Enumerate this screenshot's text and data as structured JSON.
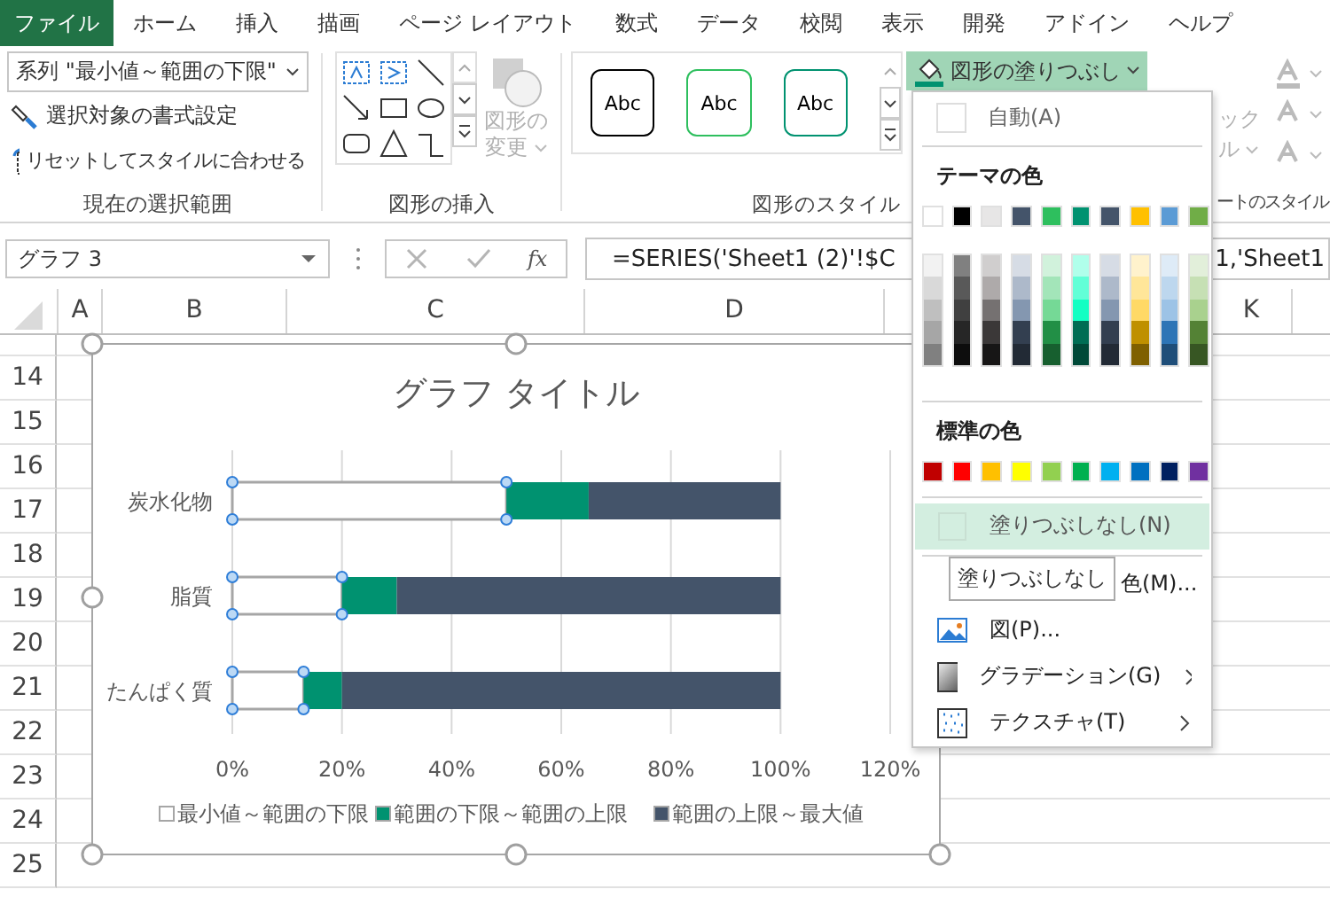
{
  "tabs": [
    {
      "label": "ファイル",
      "kind": "file"
    },
    {
      "label": "ホーム",
      "kind": "tab"
    },
    {
      "label": "挿入",
      "kind": "tab"
    },
    {
      "label": "描画",
      "kind": "tab"
    },
    {
      "label": "ページ レイアウト",
      "kind": "tab"
    },
    {
      "label": "数式",
      "kind": "tab"
    },
    {
      "label": "データ",
      "kind": "tab"
    },
    {
      "label": "校閲",
      "kind": "tab"
    },
    {
      "label": "表示",
      "kind": "tab"
    },
    {
      "label": "開発",
      "kind": "tab"
    },
    {
      "label": "アドイン",
      "kind": "tab"
    },
    {
      "label": "ヘルプ",
      "kind": "tab"
    }
  ],
  "ribbon": {
    "selection_group": {
      "dropdown": "系列 \"最小値～範囲の下限\"",
      "buttons": [
        "選択対象の書式設定",
        "リセットしてスタイルに合わせる"
      ],
      "label": "現在の選択範囲"
    },
    "insert_group": {
      "change_shape": {
        "line_1": "図形の",
        "line_2": "変更",
        "disabled": true
      },
      "label": "図形の挿入"
    },
    "style_group": {
      "presets": [
        {
          "label": "Abc",
          "color": "#000000"
        },
        {
          "label": "Abc",
          "color": "#2ebf5e"
        },
        {
          "label": "Abc",
          "color": "#009270"
        }
      ],
      "label": "図形のスタイル"
    },
    "fill_button": {
      "label": "図形の塗りつぶし",
      "expanded": true
    },
    "quick_style": {
      "line_1": "ック",
      "line_2": "ル",
      "label": "ートのスタイル"
    }
  },
  "name_box": "グラフ 3",
  "formula": {
    "function_label": "fx",
    "visible_start": "=SERIES('Sheet1 (2)'!$C",
    "visible_end": "1,'Sheet1"
  },
  "columns": [
    "A",
    "B",
    "C",
    "D",
    "K"
  ],
  "rows": [
    "14",
    "15",
    "16",
    "17",
    "18",
    "19",
    "20",
    "21",
    "22",
    "23",
    "24",
    "25"
  ],
  "chart": {
    "series_states": [
      {
        "selected": true
      },
      {
        "selected": false
      },
      {
        "selected": false
      }
    ],
    "chart_data": {
      "type": "bar",
      "orientation": "horizontal",
      "stacked": true,
      "grid": true,
      "legend": true,
      "title": "グラフ タイトル",
      "categories": [
        "炭水化物",
        "脂質",
        "たんぱく質"
      ],
      "series": [
        {
          "name": "最小値～範囲の下限",
          "color": "#ffffff",
          "values": [
            0.5,
            0.2,
            0.13
          ]
        },
        {
          "name": "範囲の下限～範囲の上限",
          "color": "#009270",
          "values": [
            0.15,
            0.1,
            0.07
          ]
        },
        {
          "name": "範囲の上限～最大値",
          "color": "#44546a",
          "values": [
            0.35,
            0.7,
            0.8
          ]
        }
      ],
      "xlim": [
        0,
        1.2
      ],
      "xticks": [
        {
          "value": 0,
          "label": "0%"
        },
        {
          "value": 0.2,
          "label": "20%"
        },
        {
          "value": 0.4,
          "label": "40%"
        },
        {
          "value": 0.6,
          "label": "60%"
        },
        {
          "value": 0.8,
          "label": "80%"
        },
        {
          "value": 1,
          "label": "100%"
        },
        {
          "value": 1.2,
          "label": "120%"
        }
      ]
    }
  },
  "fill_menu": {
    "automatic": "自動(A)",
    "theme_heading": "テーマの色",
    "theme_colors": [
      {
        "color": "#ffffff"
      },
      {
        "color": "#000000"
      },
      {
        "color": "#e7e6e6"
      },
      {
        "color": "#44546a"
      },
      {
        "color": "#2ebf5e"
      },
      {
        "color": "#009270"
      },
      {
        "color": "#44546a"
      },
      {
        "color": "#ffc000"
      },
      {
        "color": "#5b9bd5"
      },
      {
        "color": "#70ad47"
      }
    ],
    "theme_shades": [
      [
        {
          "color": "#f2f2f2"
        },
        {
          "color": "#d9d9d9"
        },
        {
          "color": "#bfbfbf"
        },
        {
          "color": "#a6a6a6"
        },
        {
          "color": "#808080"
        }
      ],
      [
        {
          "color": "#808080"
        },
        {
          "color": "#595959"
        },
        {
          "color": "#404040"
        },
        {
          "color": "#262626"
        },
        {
          "color": "#0d0d0d"
        }
      ],
      [
        {
          "color": "#d0cece"
        },
        {
          "color": "#aeaaaa"
        },
        {
          "color": "#757171"
        },
        {
          "color": "#3b3838"
        },
        {
          "color": "#171616"
        }
      ],
      [
        {
          "color": "#d6dce5"
        },
        {
          "color": "#adb9ca"
        },
        {
          "color": "#8497b0"
        },
        {
          "color": "#333f50"
        },
        {
          "color": "#222a35"
        }
      ],
      [
        {
          "color": "#d1f2dc"
        },
        {
          "color": "#a3e5b9"
        },
        {
          "color": "#75d996"
        },
        {
          "color": "#228f46"
        },
        {
          "color": "#175f2f"
        }
      ],
      [
        {
          "color": "#b0ffeb"
        },
        {
          "color": "#62ffd7"
        },
        {
          "color": "#13ffc3"
        },
        {
          "color": "#006d54"
        },
        {
          "color": "#004938"
        }
      ],
      [
        {
          "color": "#d6dce5"
        },
        {
          "color": "#adb9ca"
        },
        {
          "color": "#8497b0"
        },
        {
          "color": "#333f50"
        },
        {
          "color": "#222a35"
        }
      ],
      [
        {
          "color": "#fff2cc"
        },
        {
          "color": "#ffe699"
        },
        {
          "color": "#ffd966"
        },
        {
          "color": "#bf9000"
        },
        {
          "color": "#7f6000"
        }
      ],
      [
        {
          "color": "#deebf7"
        },
        {
          "color": "#bdd7ee"
        },
        {
          "color": "#9dc3e6"
        },
        {
          "color": "#2e75b6"
        },
        {
          "color": "#1f4e79"
        }
      ],
      [
        {
          "color": "#e2efda"
        },
        {
          "color": "#c6e0b4"
        },
        {
          "color": "#a9d18e"
        },
        {
          "color": "#548235"
        },
        {
          "color": "#375623"
        }
      ]
    ],
    "standard_heading": "標準の色",
    "standard_colors": [
      {
        "color": "#c00000"
      },
      {
        "color": "#ff0000"
      },
      {
        "color": "#ffc000"
      },
      {
        "color": "#ffff00"
      },
      {
        "color": "#92d050"
      },
      {
        "color": "#00b050"
      },
      {
        "color": "#00b0f0"
      },
      {
        "color": "#0070c0"
      },
      {
        "color": "#002060"
      },
      {
        "color": "#7030a0"
      }
    ],
    "items": [
      {
        "kind": "no_fill",
        "label": "塗りつぶしなし(N)",
        "selected": true,
        "submenu": false
      },
      {
        "kind": "more_colors",
        "label": "色(M)...",
        "selected": false,
        "submenu": false
      },
      {
        "kind": "picture",
        "label": "図(P)...",
        "selected": false,
        "submenu": false
      },
      {
        "kind": "gradient",
        "label": "グラデーション(G)",
        "selected": false,
        "submenu": true
      },
      {
        "kind": "texture",
        "label": "テクスチャ(T)",
        "selected": false,
        "submenu": true
      }
    ],
    "tooltip": "塗りつぶしなし"
  }
}
